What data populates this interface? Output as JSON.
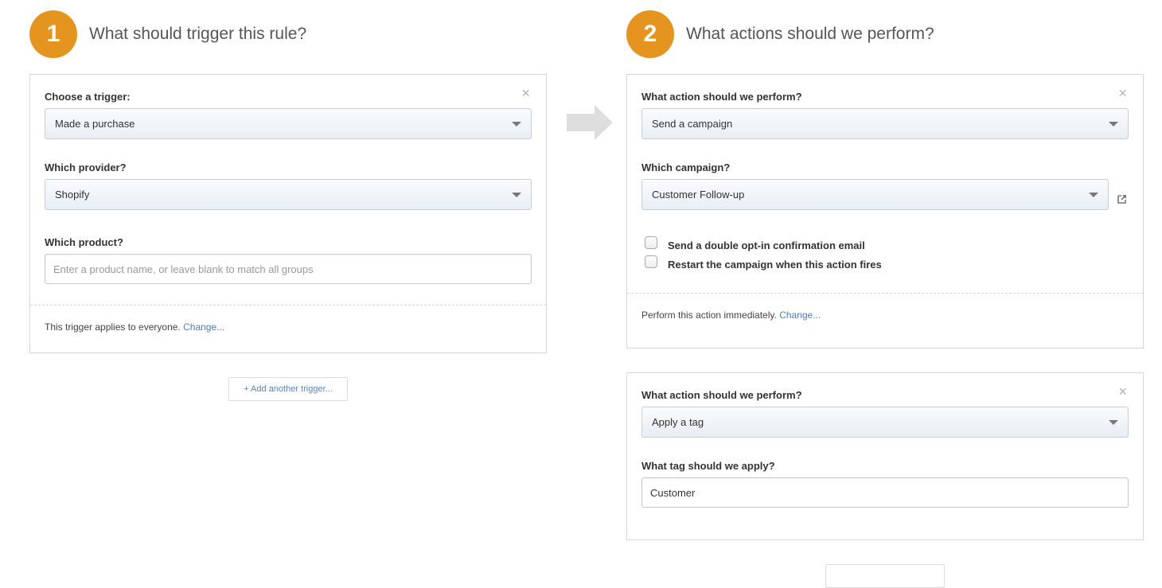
{
  "step1": {
    "number": "1",
    "title": "What should trigger this rule?",
    "trigger_label": "Choose a trigger:",
    "trigger_value": "Made a purchase",
    "provider_label": "Which provider?",
    "provider_value": "Shopify",
    "product_label": "Which product?",
    "product_value": "",
    "product_placeholder": "Enter a product name, or leave blank to match all groups",
    "footer_text": "This trigger applies to everyone.",
    "footer_link": "Change...",
    "add_button": "+ Add another trigger..."
  },
  "step2": {
    "number": "2",
    "title": "What actions should we perform?",
    "action1": {
      "action_label": "What action should we perform?",
      "action_value": "Send a campaign",
      "campaign_label": "Which campaign?",
      "campaign_value": "Customer Follow-up",
      "checkbox1": "Send a double opt-in confirmation email",
      "checkbox2": "Restart the campaign when this action fires",
      "footer_text": "Perform this action immediately.",
      "footer_link": "Change..."
    },
    "action2": {
      "action_label": "What action should we perform?",
      "action_value": "Apply a tag",
      "tag_label": "What tag should we apply?",
      "tag_value": "Customer"
    }
  },
  "icons": {
    "close": "×"
  },
  "colors": {
    "accent": "#e5951f",
    "link": "#4a7dbf"
  }
}
